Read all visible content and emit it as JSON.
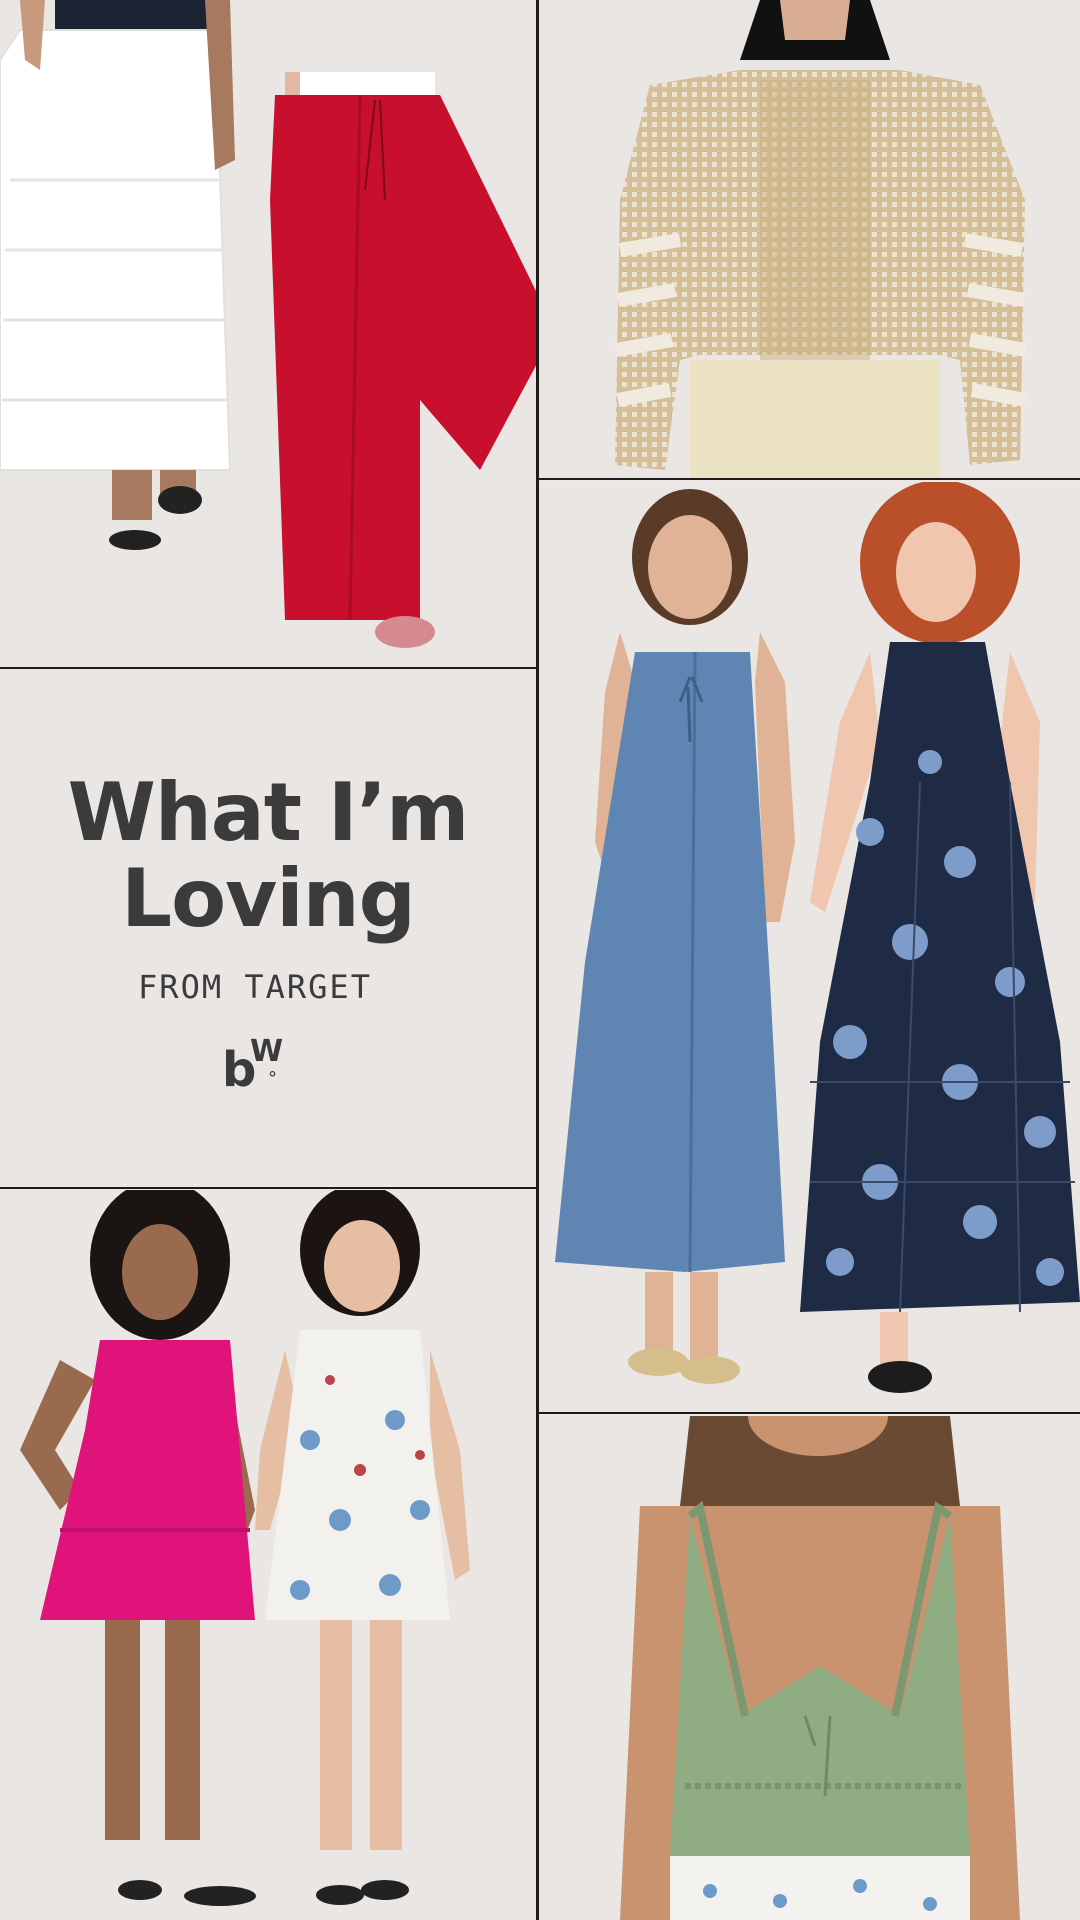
{
  "collage": {
    "title_line1": "What I’m",
    "title_line2": "Loving",
    "subtitle": "FROM TARGET",
    "logo_b": "b",
    "logo_w": "W",
    "logo_dot": "°"
  },
  "colors": {
    "background": "#e9e6e3",
    "divider": "#1c1c1c",
    "text": "#3b3b3b"
  },
  "products": [
    {
      "name": "white tiered maxi skirt",
      "color": "#ffffff"
    },
    {
      "name": "red wide-leg pants",
      "color": "#c8102e"
    },
    {
      "name": "open-knit striped sweater",
      "color": "#d9c4a0"
    },
    {
      "name": "chambray midi dress",
      "color": "#5f86b3"
    },
    {
      "name": "navy floral halter maxi dress",
      "color": "#1f2b44"
    },
    {
      "name": "pink tiered mini dress",
      "color": "#e0137b"
    },
    {
      "name": "white floral slip mini dress",
      "color": "#f3f1ee"
    },
    {
      "name": "green babydoll cami top",
      "color": "#8fac82"
    }
  ]
}
